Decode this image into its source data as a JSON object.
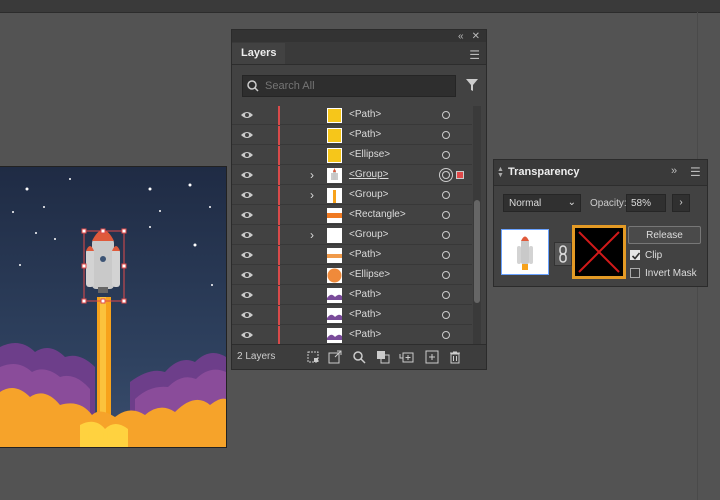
{
  "layers_panel": {
    "tab": "Layers",
    "search_placeholder": "Search All",
    "rows": [
      {
        "label": "<Path>",
        "thumb": "yellow-square",
        "expand": false
      },
      {
        "label": "<Path>",
        "thumb": "yellow-square",
        "expand": false
      },
      {
        "label": "<Ellipse>",
        "thumb": "yellow-square",
        "expand": false
      },
      {
        "label": "<Group>",
        "thumb": "rocket",
        "expand": true,
        "selected": true
      },
      {
        "label": "<Group>",
        "thumb": "beam",
        "expand": true
      },
      {
        "label": "<Rectangle>",
        "thumb": "orange-stripe",
        "expand": false
      },
      {
        "label": "<Group>",
        "thumb": "blank",
        "expand": true
      },
      {
        "label": "<Path>",
        "thumb": "orange-stripe2",
        "expand": false
      },
      {
        "label": "<Ellipse>",
        "thumb": "orange-circle",
        "expand": false
      },
      {
        "label": "<Path>",
        "thumb": "purple-wave",
        "expand": false
      },
      {
        "label": "<Path>",
        "thumb": "purple-wave",
        "expand": false
      },
      {
        "label": "<Path>",
        "thumb": "purple-wave",
        "expand": false
      }
    ],
    "footer_count": "2 Layers"
  },
  "transparency_panel": {
    "title": "Transparency",
    "blend_mode": "Normal",
    "opacity_label": "Opacity:",
    "opacity_value": "58%",
    "release_label": "Release",
    "clip_label": "Clip",
    "clip_checked": true,
    "invert_label": "Invert Mask",
    "invert_checked": false
  },
  "colors": {
    "accent_orange": "#e39a25",
    "selection_red": "#e04a4a",
    "sky": "#2a3a55",
    "flame": "#f7a21b"
  }
}
